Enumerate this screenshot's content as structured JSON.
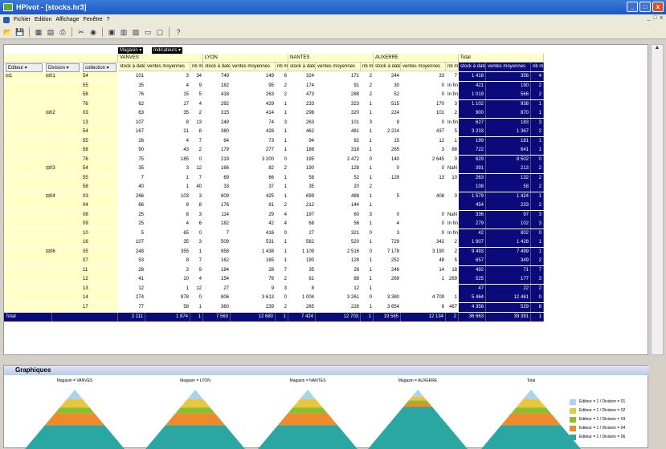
{
  "window": {
    "title": "HPivot - [stocks.hr3]",
    "minimize": "_",
    "maximize": "□",
    "close": "x"
  },
  "menu": {
    "items": [
      "Fichier",
      "Edition",
      "Affichage",
      "Fenêtre",
      "?"
    ],
    "mdi": [
      "_",
      "□",
      "x"
    ]
  },
  "toolbar": {
    "icons": [
      "open-icon",
      "save-icon",
      "chart-icon",
      "table-icon",
      "print-icon",
      "tools-icon",
      "filter-icon",
      "grid-icon",
      "grid2-icon",
      "split-icon",
      "split2-icon",
      "window-icon",
      "help-icon"
    ]
  },
  "pivot": {
    "chips": {
      "magasin": "Magasin",
      "indicateurs": "Indicateurs"
    },
    "row_selectors": [
      "Editeur",
      "Division",
      "collection"
    ],
    "stores": [
      "VANVES",
      "LYON",
      "NANTES",
      "AUXERRE",
      "Total"
    ],
    "measures": [
      "stock à date",
      "ventes moyennes",
      "nb mois"
    ],
    "rows": [
      [
        "1",
        "01",
        "54",
        "101",
        "3",
        "34",
        "749",
        "149",
        "6",
        "324",
        "171",
        "2",
        "244",
        "33",
        "7",
        "1 418",
        "356",
        "4"
      ],
      [
        "",
        "",
        "55",
        "35",
        "4",
        "9",
        "182",
        "95",
        "2",
        "174",
        "91",
        "2",
        "30",
        "0",
        "In fin ity",
        "421",
        "190",
        "2"
      ],
      [
        "",
        "",
        "58",
        "76",
        "15",
        "5",
        "418",
        "263",
        "2",
        "473",
        "288",
        "2",
        "52",
        "0",
        "In fin ity",
        "1 019",
        "566",
        "2"
      ],
      [
        "",
        "",
        "76",
        "62",
        "17",
        "4",
        "292",
        "429",
        "1",
        "233",
        "323",
        "1",
        "515",
        "170",
        "3",
        "1 102",
        "938",
        "1"
      ],
      [
        "",
        "02",
        "03",
        "63",
        "35",
        "2",
        "315",
        "414",
        "1",
        "298",
        "320",
        "1",
        "224",
        "101",
        "2",
        "900",
        "870",
        "1"
      ],
      [
        "",
        "",
        "13",
        "107",
        "8",
        "13",
        "249",
        "74",
        "3",
        "263",
        "101",
        "3",
        "8",
        "0",
        "In fin ity",
        "627",
        "183",
        "3"
      ],
      [
        "",
        "",
        "54",
        "167",
        "21",
        "8",
        "380",
        "428",
        "1",
        "462",
        "481",
        "1",
        "2 224",
        "437",
        "5",
        "3 233",
        "1 367",
        "2"
      ],
      [
        "",
        "",
        "55",
        "26",
        "4",
        "7",
        "64",
        "73",
        "1",
        "94",
        "92",
        "1",
        "15",
        "12",
        "1",
        "199",
        "181",
        "1"
      ],
      [
        "",
        "",
        "58",
        "90",
        "43",
        "2",
        "179",
        "277",
        "1",
        "188",
        "318",
        "1",
        "265",
        "3",
        "88",
        "722",
        "641",
        "1"
      ],
      [
        "",
        "",
        "76",
        "75",
        "185",
        "0",
        "219",
        "3 200",
        "0",
        "195",
        "2 472",
        "0",
        "140",
        "2 645",
        "0",
        "629",
        "8 502",
        "0"
      ],
      [
        "",
        "03",
        "54",
        "35",
        "3",
        "12",
        "166",
        "82",
        "2",
        "190",
        "128",
        "1",
        "0",
        "0",
        "NaN",
        "391",
        "213",
        "2"
      ],
      [
        "",
        "",
        "55",
        "7",
        "1",
        "7",
        "69",
        "66",
        "1",
        "58",
        "52",
        "1",
        "129",
        "13",
        "10",
        "263",
        "132",
        "2"
      ],
      [
        "",
        "",
        "58",
        "40",
        "1",
        "40",
        "33",
        "37",
        "1",
        "35",
        "20",
        "2",
        "",
        "",
        "",
        "108",
        "58",
        "2"
      ],
      [
        "",
        "04",
        "03",
        "266",
        "103",
        "3",
        "609",
        "425",
        "1",
        "699",
        "488",
        "1",
        "5",
        "408",
        "0",
        "1 579",
        "1 424",
        "1"
      ],
      [
        "",
        "",
        "04",
        "66",
        "8",
        "8",
        "176",
        "81",
        "2",
        "212",
        "144",
        "1",
        "",
        "",
        "",
        "454",
        "233",
        "2"
      ],
      [
        "",
        "",
        "08",
        "25",
        "8",
        "3",
        "114",
        "29",
        "4",
        "197",
        "60",
        "3",
        "0",
        "0",
        "NaN",
        "336",
        "97",
        "3"
      ],
      [
        "",
        "",
        "09",
        "25",
        "4",
        "6",
        "182",
        "42",
        "4",
        "68",
        "56",
        "1",
        "4",
        "0",
        "In fin ity",
        "279",
        "102",
        "3"
      ],
      [
        "",
        "",
        "10",
        "5",
        "65",
        "0",
        "7",
        "416",
        "0",
        "27",
        "321",
        "0",
        "3",
        "0",
        "In fin ity",
        "42",
        "802",
        "0"
      ],
      [
        "",
        "",
        "16",
        "107",
        "35",
        "3",
        "509",
        "531",
        "1",
        "562",
        "520",
        "1",
        "729",
        "342",
        "2",
        "1 907",
        "1 428",
        "1"
      ],
      [
        "",
        "06",
        "05",
        "248",
        "355",
        "1",
        "958",
        "1 438",
        "1",
        "1 109",
        "2 516",
        "0",
        "7 178",
        "3 190",
        "2",
        "9 493",
        "7 499",
        "1"
      ],
      [
        "",
        "",
        "07",
        "53",
        "8",
        "7",
        "162",
        "165",
        "1",
        "190",
        "128",
        "1",
        "252",
        "48",
        "5",
        "657",
        "349",
        "2"
      ],
      [
        "",
        "",
        "11",
        "28",
        "3",
        "9",
        "184",
        "28",
        "7",
        "35",
        "26",
        "1",
        "246",
        "14",
        "18",
        "492",
        "71",
        "7"
      ],
      [
        "",
        "",
        "12",
        "41",
        "10",
        "4",
        "154",
        "78",
        "2",
        "61",
        "88",
        "1",
        "269",
        "1",
        "269",
        "525",
        "177",
        "3"
      ],
      [
        "",
        "",
        "13",
        "12",
        "1",
        "12",
        "27",
        "9",
        "3",
        "8",
        "12",
        "1",
        "",
        "",
        "",
        "47",
        "22",
        "2"
      ],
      [
        "",
        "",
        "14",
        "274",
        "878",
        "0",
        "806",
        "3 613",
        "0",
        "1 004",
        "3 261",
        "0",
        "3 380",
        "4 709",
        "1",
        "5 464",
        "12 461",
        "0"
      ],
      [
        "",
        "",
        "17",
        "77",
        "58",
        "1",
        "360",
        "239",
        "2",
        "265",
        "226",
        "1",
        "3 654",
        "8",
        "467",
        "4 356",
        "529",
        "8"
      ]
    ],
    "total": [
      "Total",
      "2 111",
      "1 874",
      "1",
      "7 563",
      "12 680",
      "1",
      "7 424",
      "12 703",
      "1",
      "19 565",
      "12 134",
      "2",
      "36 663",
      "39 391",
      "1"
    ]
  },
  "graph": {
    "title": "Graphiques",
    "charts": [
      "Magasin = VANVES",
      "Magasin = LYON",
      "Magasin = NANTES",
      "Magasin = AUXERRE",
      "Total"
    ],
    "legend": [
      {
        "label": "Editeur = 1 / Division = 01",
        "color": "#a9d4ea"
      },
      {
        "label": "Editeur = 1 / Division = 02",
        "color": "#e8c640"
      },
      {
        "label": "Editeur = 1 / Division = 03",
        "color": "#8bbd2c"
      },
      {
        "label": "Editeur = 1 / Division = 04",
        "color": "#ee8a2c"
      },
      {
        "label": "Editeur = 1 / Division = 06",
        "color": "#2aa7a0"
      }
    ]
  }
}
